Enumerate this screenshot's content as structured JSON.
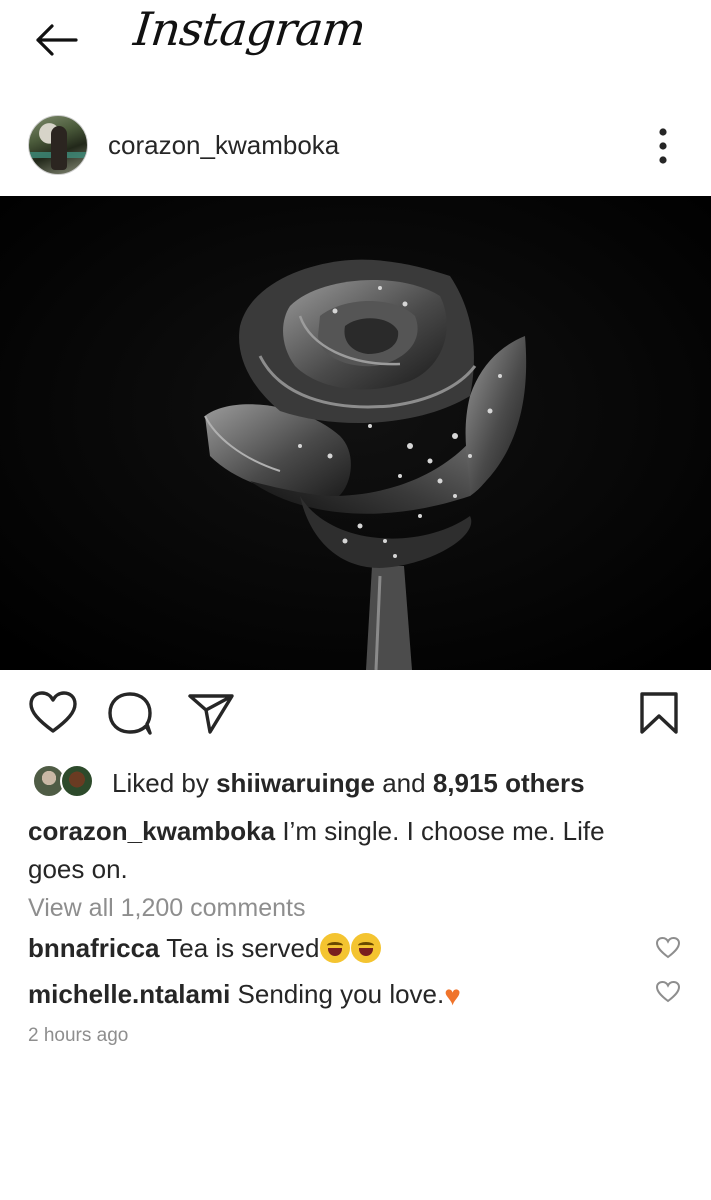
{
  "header": {
    "app_title": "Instagram"
  },
  "post": {
    "username": "corazon_kwamboka",
    "likes": {
      "liked_by_prefix": "Liked by ",
      "liked_by_user": "shiiwaruinge",
      "and_text": " and ",
      "others_text": "8,915 others"
    },
    "caption": {
      "username": "corazon_kwamboka",
      "text": " I’m single. I choose me. Life goes on."
    },
    "view_all_comments": "View all 1,200 comments",
    "comments": [
      {
        "username": "bnnafricca",
        "text": " Tea is served",
        "emoji": [
          "face-with-tears-of-joy",
          "face-with-tears-of-joy"
        ]
      },
      {
        "username": "michelle.ntalami",
        "text": " Sending you love.",
        "emoji": [
          "orange-heart"
        ]
      }
    ],
    "timestamp": "2 hours ago"
  },
  "colors": {
    "text": "#262626",
    "muted": "#8e8e8e",
    "orange_heart": "#f0742b",
    "image_background": "#000000"
  },
  "icons": [
    "back-arrow-icon",
    "more-vertical-icon",
    "heart-icon",
    "comment-icon",
    "share-icon",
    "bookmark-icon"
  ]
}
